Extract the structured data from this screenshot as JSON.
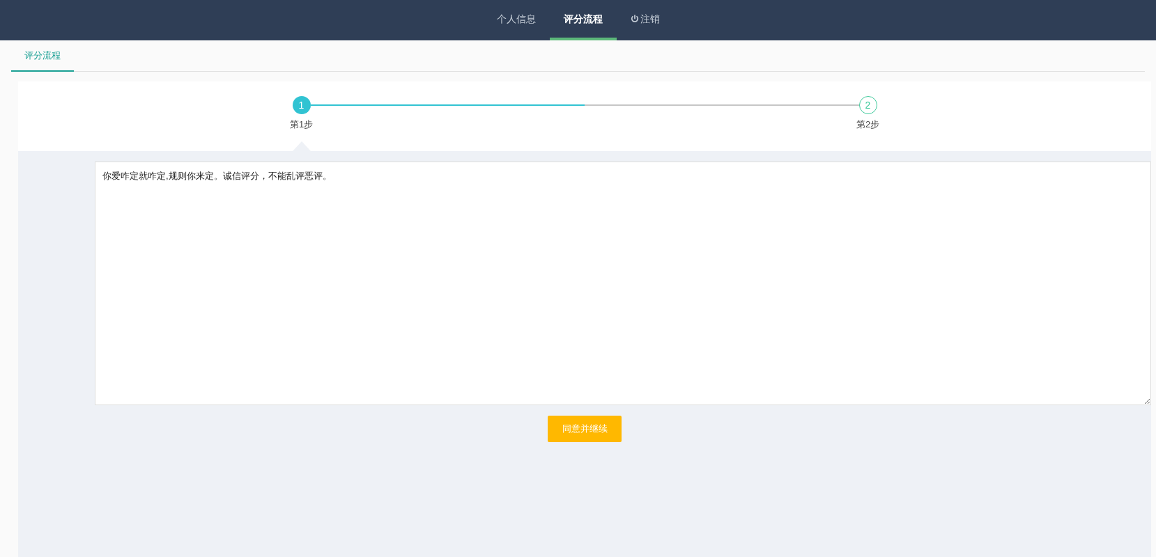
{
  "nav": {
    "items": [
      {
        "label": "个人信息",
        "selected": false,
        "kind": "link"
      },
      {
        "label": "评分流程",
        "selected": true,
        "kind": "link"
      },
      {
        "label": "注销",
        "selected": false,
        "kind": "logout"
      }
    ]
  },
  "tabs": [
    {
      "label": "评分流程",
      "selected": true
    }
  ],
  "steps": {
    "level": 0.5,
    "items": [
      {
        "number": "1",
        "label": "第1步",
        "active": true
      },
      {
        "number": "2",
        "label": "第2步",
        "active": false
      }
    ]
  },
  "agreement": {
    "value": "你爱咋定就咋定,规则你来定。诚信评分，不能乱评恶评。"
  },
  "button": "同意并继续"
}
